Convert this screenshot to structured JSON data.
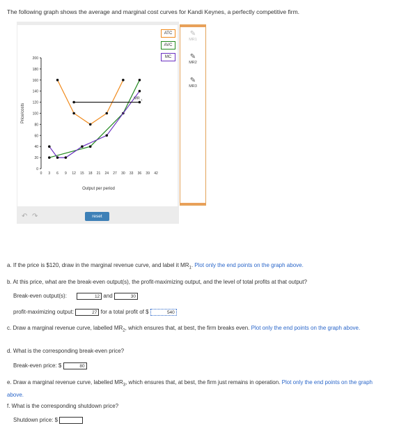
{
  "intro": "The following graph shows the average and marginal cost curves for Kandi Keynes, a perfectly competitive firm.",
  "graph": {
    "ylabel": "Price/costs",
    "xlabel": "Output per period",
    "yticks": [
      "0",
      "20",
      "40",
      "60",
      "80",
      "100",
      "120",
      "140",
      "160",
      "180",
      "200"
    ],
    "xticks": [
      "0",
      "3",
      "6",
      "9",
      "12",
      "15",
      "18",
      "21",
      "24",
      "27",
      "30",
      "33",
      "36",
      "39",
      "42"
    ],
    "legend": [
      "ATC",
      "AVC",
      "MC"
    ],
    "mr1_label": "MR",
    "mr1_sub": "1",
    "reset_label": "reset",
    "colors": {
      "ATC": "#f08a1c",
      "AVC": "#22891f",
      "MC": "#6a2fc0",
      "MR": "#222222"
    }
  },
  "chart_data": {
    "type": "line",
    "xlabel": "Output per period",
    "ylabel": "Price/costs",
    "xlim": [
      0,
      42
    ],
    "ylim": [
      0,
      200
    ],
    "series": [
      {
        "name": "ATC",
        "x": [
          6,
          12,
          18,
          24,
          30
        ],
        "y": [
          160,
          100,
          80,
          100,
          160
        ]
      },
      {
        "name": "AVC",
        "x": [
          3,
          18,
          30,
          36
        ],
        "y": [
          20,
          40,
          100,
          160
        ]
      },
      {
        "name": "MC",
        "x": [
          3,
          6,
          9,
          15,
          24,
          36
        ],
        "y": [
          40,
          20,
          20,
          40,
          60,
          140
        ]
      },
      {
        "name": "MR1",
        "x": [
          12,
          36
        ],
        "y": [
          120,
          120
        ]
      }
    ]
  },
  "tools": [
    {
      "label": "MR1",
      "disabled": true
    },
    {
      "label": "MR2",
      "disabled": false
    },
    {
      "label": "MR3",
      "disabled": false
    }
  ],
  "questions": {
    "a_text": "a. If the price is $120, draw in the marginal revenue curve, and label it MR",
    "a_sub": "1",
    "a_link": "Plot only the end points on the graph above.",
    "b_text": "b. At this price, what are the break-even output(s), the profit-maximizing output, and the level of total profits at that output?",
    "b_breakeven_label": "Break-even output(s):",
    "b_be1": "12",
    "b_and": "and",
    "b_be2": "30",
    "b_pm_label": "profit-maximizing output:",
    "b_pm": "27",
    "b_profit_label": "for a total profit of $",
    "b_profit": "540",
    "c_text": "c. Draw a marginal revenue curve, labelled MR",
    "c_sub": "2",
    "c_text2": ", which ensures that, at best, the firm breaks even.",
    "c_link": "Plot only the end points on the graph above.",
    "d_text": "d. What is the corresponding break-even price?",
    "d_label": "Break-even price: $",
    "d_value": "80",
    "e_text": "e. Draw a marginal revenue curve, labelled MR",
    "e_sub": "3",
    "e_text2": ", which ensures that, at best, the firm just remains in operation.",
    "e_link": "Plot only the end points on the graph above.",
    "f_text": "f. What is the corresponding shutdown price?",
    "f_label": "Shutdown price: $",
    "f_value": ""
  }
}
